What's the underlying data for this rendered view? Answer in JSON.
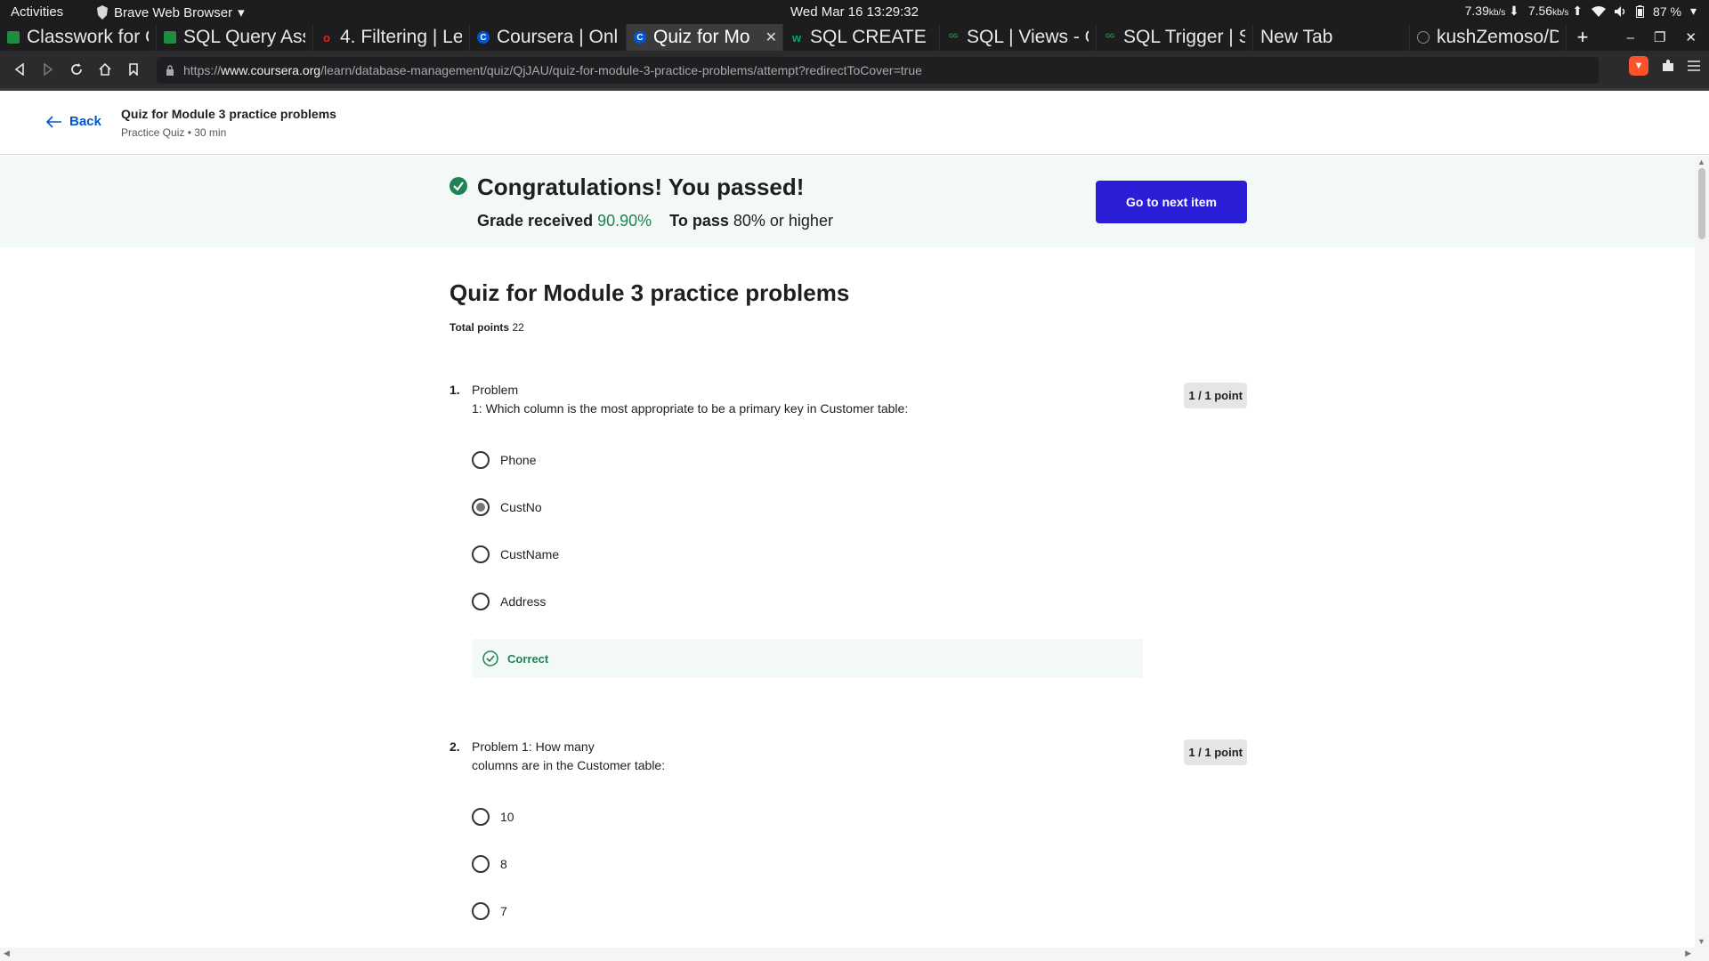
{
  "system": {
    "activities": "Activities",
    "app_name": "Brave Web Browser",
    "clock": "Wed Mar 16  13:29:32",
    "net_down": "7.39",
    "net_up": "7.56",
    "net_unit": "kb/s",
    "battery": "87 %"
  },
  "tabs": [
    {
      "title": "Classwork for C",
      "favicon_color": "#1e8e3e",
      "favicon": "classroom-icon"
    },
    {
      "title": "SQL Query Ass",
      "favicon_color": "#1e8e3e",
      "favicon": "classroom-icon"
    },
    {
      "title": "4. Filtering | Le",
      "favicon_color": "#e2231a",
      "favicon": "o-icon"
    },
    {
      "title": "Coursera | Onli",
      "favicon_color": "#0056d2",
      "favicon": "coursera-icon"
    },
    {
      "title": "Quiz for Mo",
      "favicon_color": "#0056d2",
      "favicon": "coursera-icon",
      "active": true
    },
    {
      "title": "SQL CREATE VI",
      "favicon_color": "#04aa6d",
      "favicon": "w3schools-icon"
    },
    {
      "title": "SQL | Views - G",
      "favicon_color": "#2f8d46",
      "favicon": "gfg-icon"
    },
    {
      "title": "SQL Trigger | S",
      "favicon_color": "#2f8d46",
      "favicon": "gfg-icon"
    },
    {
      "title": "New Tab",
      "favicon_color": "",
      "favicon": ""
    },
    {
      "title": "kushZemoso/D",
      "favicon_color": "#555555",
      "favicon": "github-icon"
    }
  ],
  "url": {
    "prefix": "https://",
    "host": "www.coursera.org",
    "path": "/learn/database-management/quiz/QjJAU/quiz-for-module-3-practice-problems/attempt?redirectToCover=true"
  },
  "header": {
    "back_label": "Back",
    "quiz_title": "Quiz for Module 3 practice problems",
    "quiz_meta": "Practice Quiz • 30 min"
  },
  "banner": {
    "title": "Congratulations! You passed!",
    "grade_label": "Grade received",
    "grade_value": "90.90%",
    "pass_label": "To pass",
    "pass_value": "80% or higher",
    "next_button": "Go to next item",
    "accent": "#1f8354"
  },
  "quiz": {
    "title": "Quiz for Module 3 practice problems",
    "total_label": "Total points",
    "total_value": "22"
  },
  "questions": [
    {
      "number": "1.",
      "text_line1": "Problem",
      "text_line2": "1: Which column is the most appropriate to be a primary key in Customer table:",
      "points": "1 / 1 point",
      "options": [
        "Phone",
        "CustNo",
        "CustName",
        "Address"
      ],
      "selected": 1,
      "feedback": "Correct"
    },
    {
      "number": "2.",
      "text_line1": "Problem 1: How many",
      "text_line2": "columns are in the Customer table:",
      "points": "1 / 1 point",
      "options": [
        "10",
        "8",
        "7"
      ]
    }
  ]
}
